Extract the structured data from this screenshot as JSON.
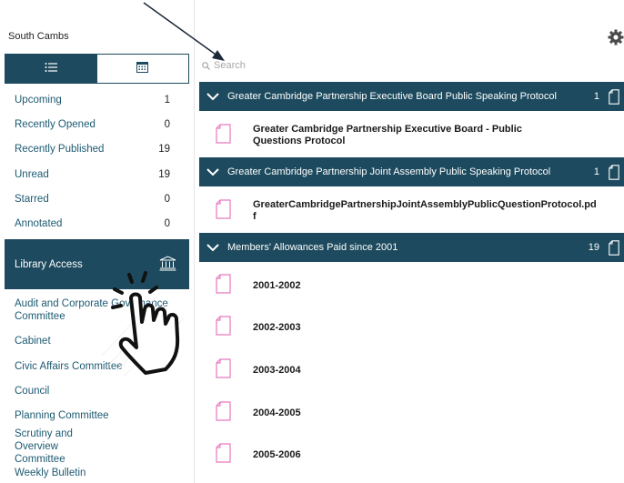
{
  "app": {
    "title": "South Cambs"
  },
  "icons": {
    "settings": "gear-icon",
    "list_view": "list-icon",
    "calendar_view": "calendar-icon",
    "library": "bank-icon",
    "search": "search-icon",
    "expand": "chevron-down-icon",
    "document": "document-icon"
  },
  "colors": {
    "accent": "#1d4a5e",
    "link": "#1d5a72",
    "doc_icon": "#e879c0"
  },
  "filters": [
    {
      "label": "Upcoming",
      "count": "1"
    },
    {
      "label": "Recently Opened",
      "count": "0"
    },
    {
      "label": "Recently Published",
      "count": "19"
    },
    {
      "label": "Unread",
      "count": "19"
    },
    {
      "label": "Starred",
      "count": "0"
    },
    {
      "label": "Annotated",
      "count": "0"
    }
  ],
  "library": {
    "label": "Library Access"
  },
  "committees": [
    "Audit and Corporate Governance Committee",
    "Cabinet",
    "Civic Affairs Committee",
    "Council",
    "Planning Committee",
    "Scrutiny and Overview Committee",
    "Weekly Bulletin"
  ],
  "search": {
    "placeholder": "Search"
  },
  "groups": [
    {
      "title": "Greater Cambridge Partnership Executive Board Public Speaking Protocol",
      "count": "1",
      "docs": [
        "Greater Cambridge Partnership Executive Board - Public Questions Protocol"
      ]
    },
    {
      "title": "Greater Cambridge Partnership Joint Assembly Public Speaking Protocol",
      "count": "1",
      "docs": [
        "GreaterCambridgePartnershipJointAssemblyPublicQuestionProtocol.pdf"
      ]
    },
    {
      "title": "Members' Allowances Paid since 2001",
      "count": "19",
      "docs": [
        "2001-2002",
        "2002-2003",
        "2003-2004",
        "2004-2005",
        "2005-2006"
      ]
    }
  ]
}
